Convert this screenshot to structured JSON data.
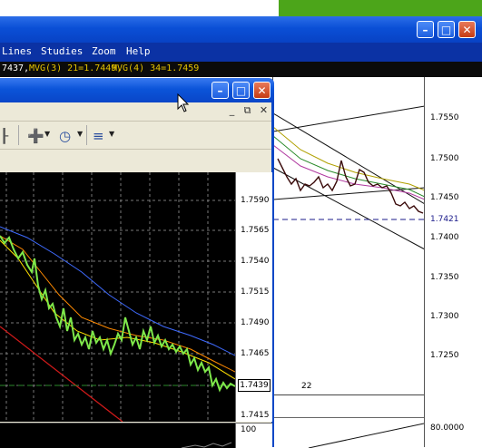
{
  "back_window": {
    "menu": [
      "Lines",
      "Studies",
      "Zoom",
      "Help"
    ],
    "status": [
      {
        "text": "7437,",
        "color": "#ffffff"
      },
      {
        "text": "MVG(3) 21=1.7449,",
        "color": "#e4c200"
      },
      {
        "text": "MVG(4) 34=1.7459",
        "color": "#e4c200"
      }
    ],
    "price_axis": [
      "1.7550",
      "1.7500",
      "1.7450",
      "1.7421",
      "1.7400",
      "1.7350",
      "1.7300",
      "1.7250"
    ],
    "current_price": "1.7421",
    "date_label": "22",
    "lower_axis": "80.0000",
    "buttons": {
      "minimize": "–",
      "maximize": "□",
      "close": "✕"
    }
  },
  "front_window": {
    "buttons": {
      "minimize": "–",
      "maximize": "□",
      "close": "✕"
    },
    "inner_buttons": {
      "minimize": "_",
      "restore": "⧉",
      "close": "✕"
    },
    "toolbar_icons": [
      "line-tool-icon",
      "add-indicator-icon",
      "clock-icon",
      "chart-template-icon"
    ],
    "price_axis": [
      "1.7590",
      "1.7565",
      "1.7540",
      "1.7515",
      "1.7490",
      "1.7465",
      "1.7415"
    ],
    "current_price": "1.7439",
    "lower_axis": "100"
  },
  "colors": {
    "title_blue": "#0a4fd6",
    "menu_blue": "#0b32a4",
    "candles": "#7ee84a",
    "ma_blue": "#3f6bff",
    "ma_orange": "#ff8a00",
    "ma_yellow": "#ffe000",
    "trend_red": "#d11a1a"
  }
}
